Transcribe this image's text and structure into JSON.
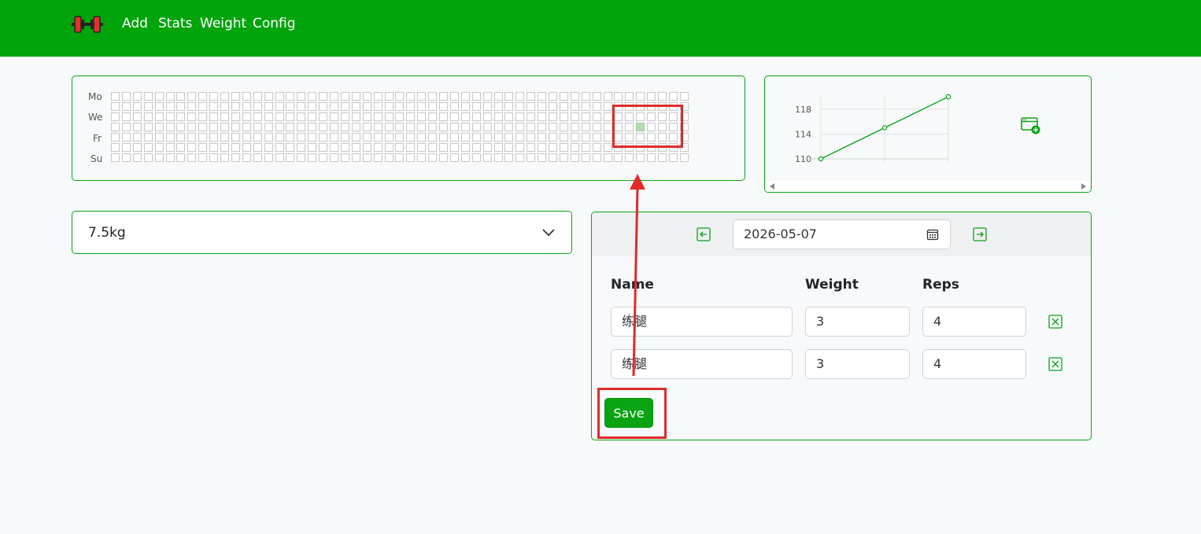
{
  "navbar": {
    "logo_icon": "dumbbell-icon",
    "links": [
      {
        "label": "Add"
      },
      {
        "label": "Stats"
      },
      {
        "label": "Weight"
      },
      {
        "label": "Config"
      }
    ],
    "background": "#02a40c"
  },
  "heatmap": {
    "day_labels": [
      "Mo",
      "We",
      "Fr",
      "Su"
    ],
    "weeks": 53,
    "days_per_week": 7,
    "completed_cells": [
      {
        "week": 48,
        "day": 3
      }
    ]
  },
  "chart_data": {
    "type": "line",
    "x": [
      1,
      2,
      3
    ],
    "values": [
      110,
      115,
      120
    ],
    "yticks": [
      110,
      114,
      118
    ],
    "grid": true,
    "color": "#0aa312"
  },
  "weight_chart_panel": {
    "add_icon": "add-calendar-icon"
  },
  "weight_select": {
    "value": "7.5kg"
  },
  "workout_form": {
    "date": "2026-05-07",
    "prev_icon": "arrow-left-icon",
    "next_icon": "arrow-right-icon",
    "calendar_icon": "calendar-icon",
    "columns": {
      "name": "Name",
      "weight": "Weight",
      "reps": "Reps"
    },
    "rows": [
      {
        "name": "练腿",
        "weight": "3",
        "reps": "4"
      },
      {
        "name": "练腿",
        "weight": "3",
        "reps": "4"
      }
    ],
    "save_label": "Save"
  },
  "colors": {
    "accent": "#0aa312",
    "annotation": "#e02b2b"
  }
}
